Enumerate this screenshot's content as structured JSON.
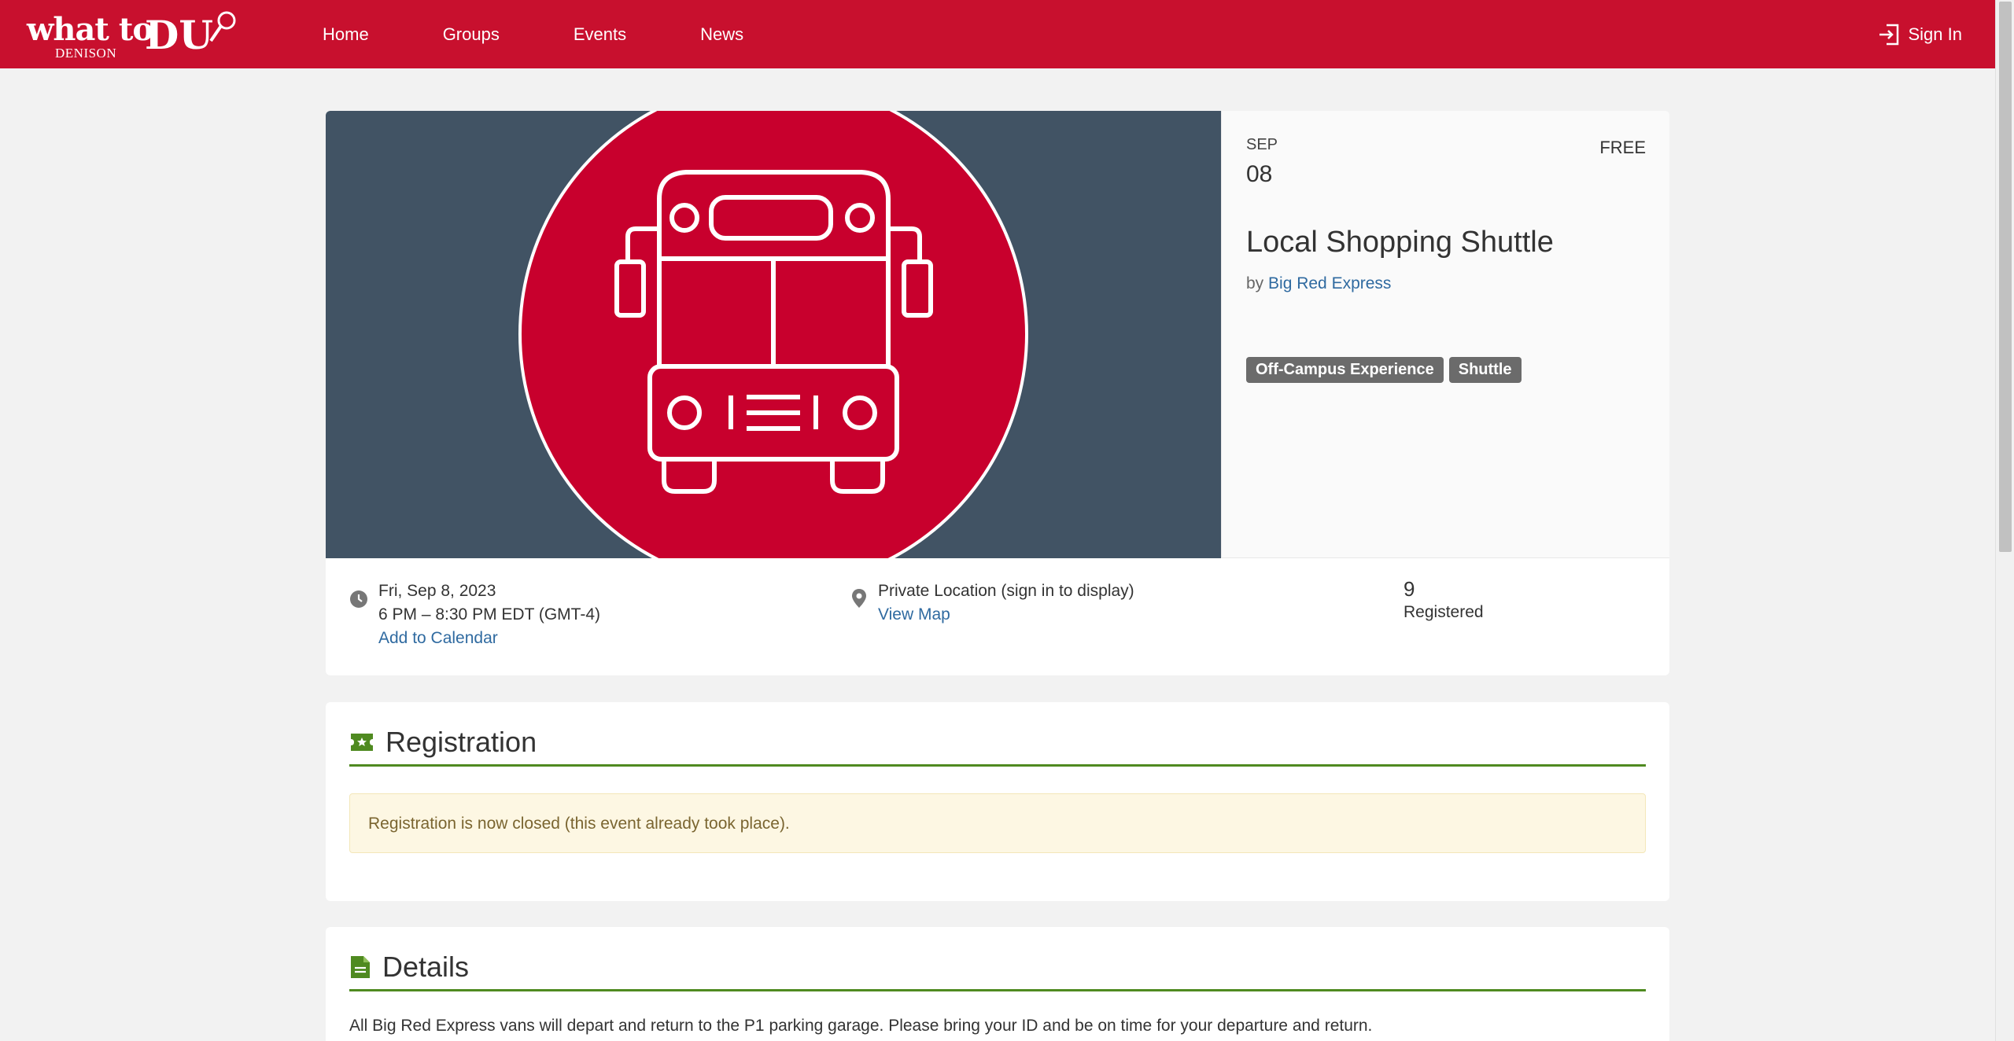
{
  "brand": {
    "line1": "what to",
    "line2": "DENISON",
    "mark": "DU"
  },
  "nav": {
    "items": [
      "Home",
      "Groups",
      "Events",
      "News"
    ]
  },
  "header": {
    "signin_label": "Sign In"
  },
  "event": {
    "month": "SEP",
    "day": "08",
    "price": "FREE",
    "title": "Local Shopping Shuttle",
    "by_prefix": "by",
    "organizer": "Big Red Express",
    "tags": [
      "Off-Campus Experience",
      "Shuttle"
    ],
    "date": "Fri, Sep 8, 2023",
    "time": "6 PM – 8:30 PM EDT (GMT-4)",
    "add_calendar": "Add to Calendar",
    "location": "Private Location (sign in to display)",
    "view_map": "View Map",
    "registered_count": "9",
    "registered_label": "Registered"
  },
  "registration": {
    "heading": "Registration",
    "notice": "Registration is now closed (this event already took place)."
  },
  "details": {
    "heading": "Details",
    "text": "All Big Red Express vans will depart and return to the P1 parking garage. Please bring your ID and be on time for your departure and return."
  },
  "colors": {
    "brand_red": "#c8102e",
    "accent_green": "#4f8a20",
    "hero_bg": "#415364",
    "link": "#2f6aa0"
  },
  "icons": [
    "bus-icon",
    "clock-icon",
    "map-pin-icon",
    "ticket-icon",
    "document-icon",
    "signin-icon"
  ]
}
